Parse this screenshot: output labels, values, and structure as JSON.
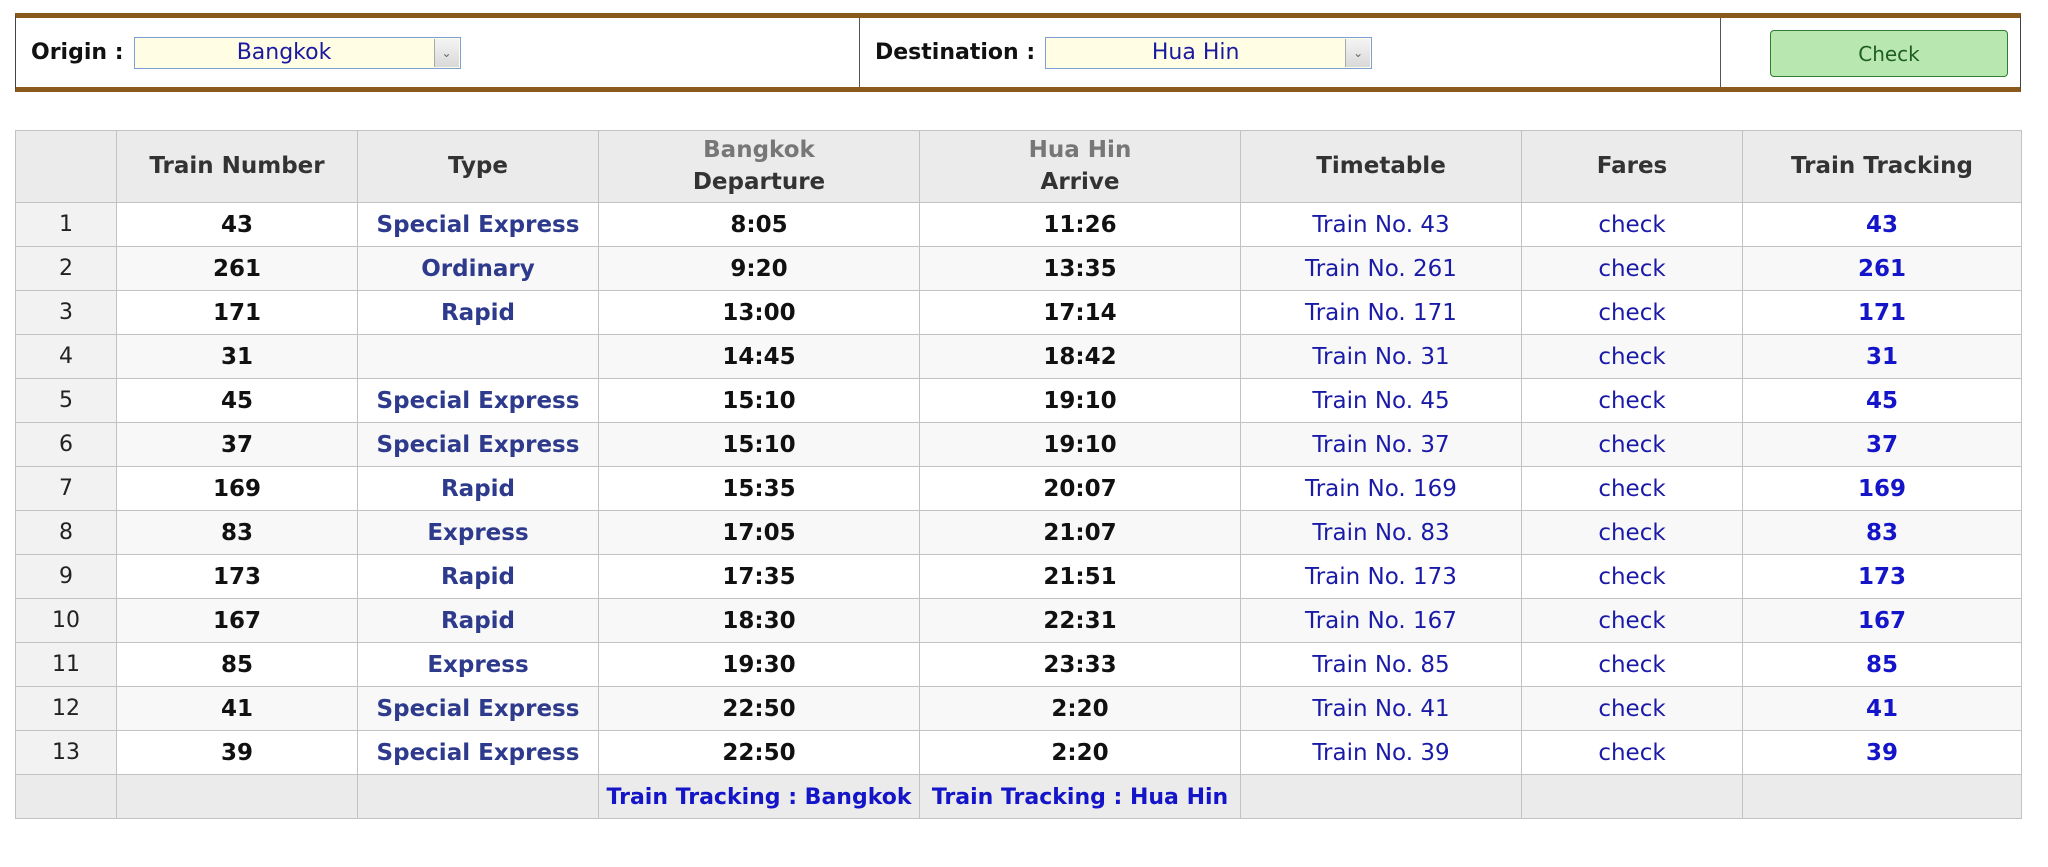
{
  "search": {
    "origin_label": "Origin :",
    "origin_value": "Bangkok",
    "destination_label": "Destination :",
    "destination_value": "Hua Hin",
    "check_label": "Check"
  },
  "table": {
    "headers": {
      "train_number": "Train Number",
      "type": "Type",
      "departure_station": "Bangkok",
      "departure": "Departure",
      "arrive_station": "Hua Hin",
      "arrive": "Arrive",
      "timetable": "Timetable",
      "fares": "Fares",
      "tracking": "Train Tracking"
    },
    "rows": [
      {
        "n": "1",
        "train": "43",
        "type": "Special Express",
        "dep": "8:05",
        "arr": "11:26",
        "timetable": "Train No. 43",
        "fares": "check",
        "track": "43"
      },
      {
        "n": "2",
        "train": "261",
        "type": "Ordinary",
        "dep": "9:20",
        "arr": "13:35",
        "timetable": "Train No. 261",
        "fares": "check",
        "track": "261"
      },
      {
        "n": "3",
        "train": "171",
        "type": "Rapid",
        "dep": "13:00",
        "arr": "17:14",
        "timetable": "Train No. 171",
        "fares": "check",
        "track": "171"
      },
      {
        "n": "4",
        "train": "31",
        "type": "",
        "dep": "14:45",
        "arr": "18:42",
        "timetable": "Train No. 31",
        "fares": "check",
        "track": "31"
      },
      {
        "n": "5",
        "train": "45",
        "type": "Special Express",
        "dep": "15:10",
        "arr": "19:10",
        "timetable": "Train No. 45",
        "fares": "check",
        "track": "45"
      },
      {
        "n": "6",
        "train": "37",
        "type": "Special Express",
        "dep": "15:10",
        "arr": "19:10",
        "timetable": "Train No. 37",
        "fares": "check",
        "track": "37"
      },
      {
        "n": "7",
        "train": "169",
        "type": "Rapid",
        "dep": "15:35",
        "arr": "20:07",
        "timetable": "Train No. 169",
        "fares": "check",
        "track": "169"
      },
      {
        "n": "8",
        "train": "83",
        "type": "Express",
        "dep": "17:05",
        "arr": "21:07",
        "timetable": "Train No. 83",
        "fares": "check",
        "track": "83"
      },
      {
        "n": "9",
        "train": "173",
        "type": "Rapid",
        "dep": "17:35",
        "arr": "21:51",
        "timetable": "Train No. 173",
        "fares": "check",
        "track": "173"
      },
      {
        "n": "10",
        "train": "167",
        "type": "Rapid",
        "dep": "18:30",
        "arr": "22:31",
        "timetable": "Train No. 167",
        "fares": "check",
        "track": "167"
      },
      {
        "n": "11",
        "train": "85",
        "type": "Express",
        "dep": "19:30",
        "arr": "23:33",
        "timetable": "Train No. 85",
        "fares": "check",
        "track": "85"
      },
      {
        "n": "12",
        "train": "41",
        "type": "Special Express",
        "dep": "22:50",
        "arr": "2:20",
        "timetable": "Train No. 41",
        "fares": "check",
        "track": "41"
      },
      {
        "n": "13",
        "train": "39",
        "type": "Special Express",
        "dep": "22:50",
        "arr": "2:20",
        "timetable": "Train No. 39",
        "fares": "check",
        "track": "39"
      }
    ],
    "footer": {
      "tracking_origin": "Train Tracking : Bangkok",
      "tracking_destination": "Train Tracking : Hua Hin"
    }
  }
}
